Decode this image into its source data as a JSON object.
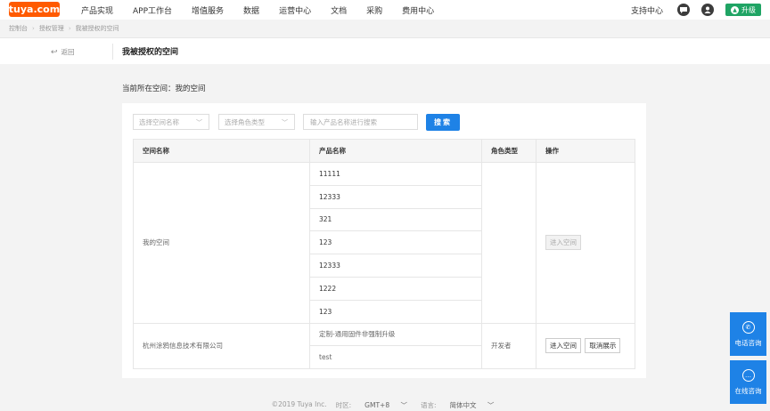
{
  "brand": {
    "logo_text": "tuya.com",
    "color": "#ff5a00"
  },
  "nav": [
    "产品实现",
    "APP工作台",
    "增值服务",
    "数据",
    "运营中心",
    "文档",
    "采购",
    "费用中心"
  ],
  "topright": {
    "support": "支持中心",
    "upgrade": "升级",
    "upgrade_color": "#1fa464",
    "icons": [
      "message-icon",
      "user-avatar-icon",
      "upgrade-arrow-icon"
    ]
  },
  "breadcrumb": [
    "控制台",
    "授权管理",
    "我被授权的空间"
  ],
  "header": {
    "back": "返回",
    "title": "我被授权的空间"
  },
  "current_space": "当前所在空间：我的空间",
  "filters": {
    "space_placeholder": "选择空间名称",
    "role_placeholder": "选择角色类型",
    "product_placeholder": "输入产品名称进行搜索",
    "search_label": "搜索",
    "accent": "#1e82e6"
  },
  "table": {
    "columns": [
      "空间名称",
      "产品名称",
      "角色类型",
      "操作"
    ],
    "groups": [
      {
        "space": "我的空间",
        "products": [
          "11111",
          "12333",
          "321",
          "123",
          "12333",
          "1222",
          "123"
        ],
        "role": "",
        "actions": [
          "进入空间"
        ],
        "action_disabled": true
      },
      {
        "space": "杭州涂鸦信息技术有限公司",
        "products": [
          "定制-通用固件非强制升级",
          "test"
        ],
        "role": "开发者",
        "actions": [
          "进入空间",
          "取消展示"
        ],
        "action_disabled": false
      }
    ]
  },
  "footer": {
    "copyright": "©2019 Tuya Inc.",
    "timezone_label": "时区:",
    "timezone": "GMT+8",
    "language_label": "语言:",
    "language": "简体中文"
  },
  "float": {
    "phone": "电话咨询",
    "online": "在线咨询"
  }
}
